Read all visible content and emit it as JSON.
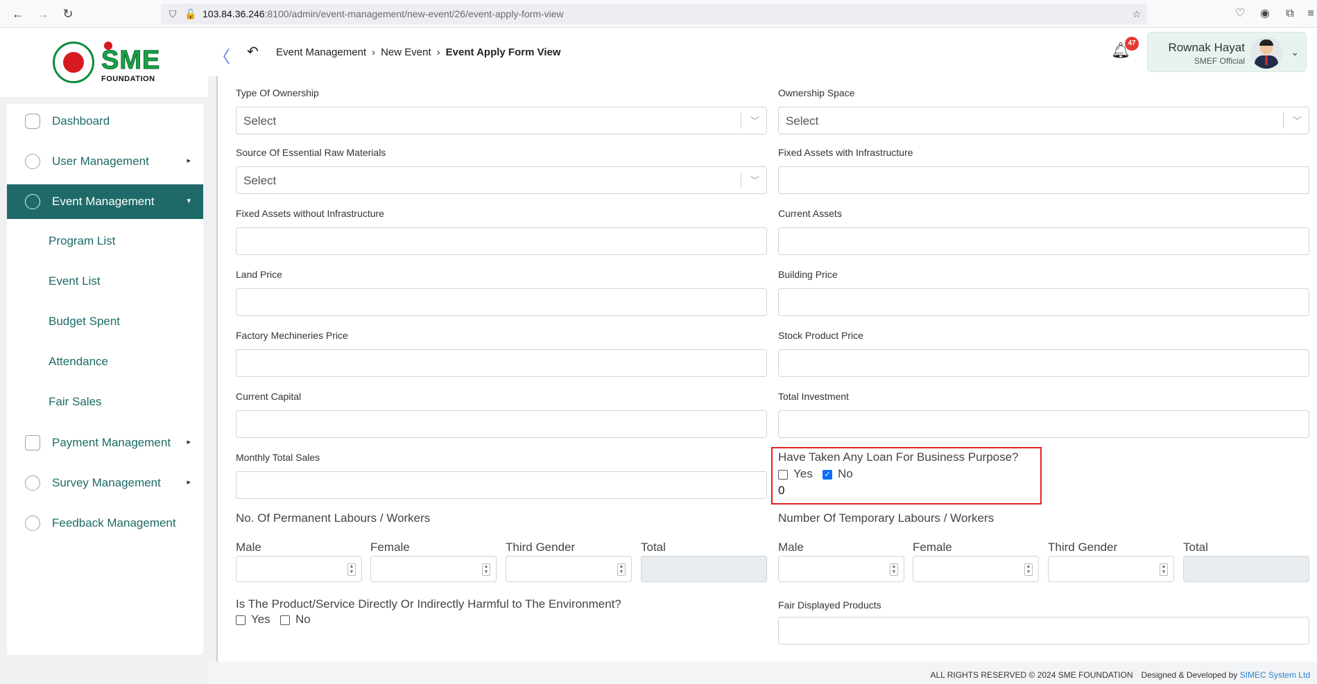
{
  "browser": {
    "url_host": "103.84.36.246",
    "url_rest": ":8100/admin/event-management/new-event/26/event-apply-form-view"
  },
  "brand": {
    "logo_text": "SME",
    "logo_sub": "FOUNDATION"
  },
  "sidebar": {
    "items": [
      {
        "label": "Dashboard"
      },
      {
        "label": "User Management"
      },
      {
        "label": "Event Management"
      },
      {
        "label": "Payment Management"
      },
      {
        "label": "Survey Management"
      },
      {
        "label": "Feedback Management"
      }
    ],
    "subitems": [
      {
        "label": "Program List"
      },
      {
        "label": "Event List"
      },
      {
        "label": "Budget Spent"
      },
      {
        "label": "Attendance"
      },
      {
        "label": "Fair Sales"
      }
    ]
  },
  "header": {
    "breadcrumb": [
      "Event Management",
      "New Event",
      "Event Apply Form View"
    ],
    "notification_count": "47",
    "user_name": "Rownak Hayat",
    "user_role": "SMEF Official"
  },
  "form": {
    "type_of_ownership": {
      "label": "Type Of Ownership",
      "value": "Select"
    },
    "ownership_space": {
      "label": "Ownership Space",
      "value": "Select"
    },
    "raw_materials": {
      "label": "Source Of Essential Raw Materials",
      "value": "Select"
    },
    "fixed_assets_infra": {
      "label": "Fixed Assets with Infrastructure"
    },
    "fixed_assets_no_infra": {
      "label": "Fixed Assets without Infrastructure"
    },
    "current_assets": {
      "label": "Current Assets"
    },
    "land_price": {
      "label": "Land Price"
    },
    "building_price": {
      "label": "Building Price"
    },
    "factory_price": {
      "label": "Factory Mechineries Price"
    },
    "stock_price": {
      "label": "Stock Product Price"
    },
    "current_capital": {
      "label": "Current Capital"
    },
    "total_investment": {
      "label": "Total Investment"
    },
    "monthly_sales": {
      "label": "Monthly Total Sales"
    },
    "loan": {
      "label": "Have Taken Any Loan For Business Purpose?",
      "yes": "Yes",
      "no": "No",
      "value": "0"
    },
    "permanent": {
      "label": "No. Of Permanent Labours / Workers",
      "male": "Male",
      "female": "Female",
      "third": "Third Gender",
      "total": "Total"
    },
    "temporary": {
      "label": "Number Of Temporary Labours / Workers",
      "male": "Male",
      "female": "Female",
      "third": "Third Gender",
      "total": "Total"
    },
    "harmful": {
      "label": "Is The Product/Service Directly Or Indirectly Harmful to The Environment?",
      "yes": "Yes",
      "no": "No"
    },
    "fair_products": {
      "label": "Fair Displayed Products"
    }
  },
  "footer": {
    "rights": "ALL RIGHTS RESERVED © 2024 SME FOUNDATION",
    "designed": "Designed & Developed by",
    "developer": "SIMEC System Ltd"
  }
}
